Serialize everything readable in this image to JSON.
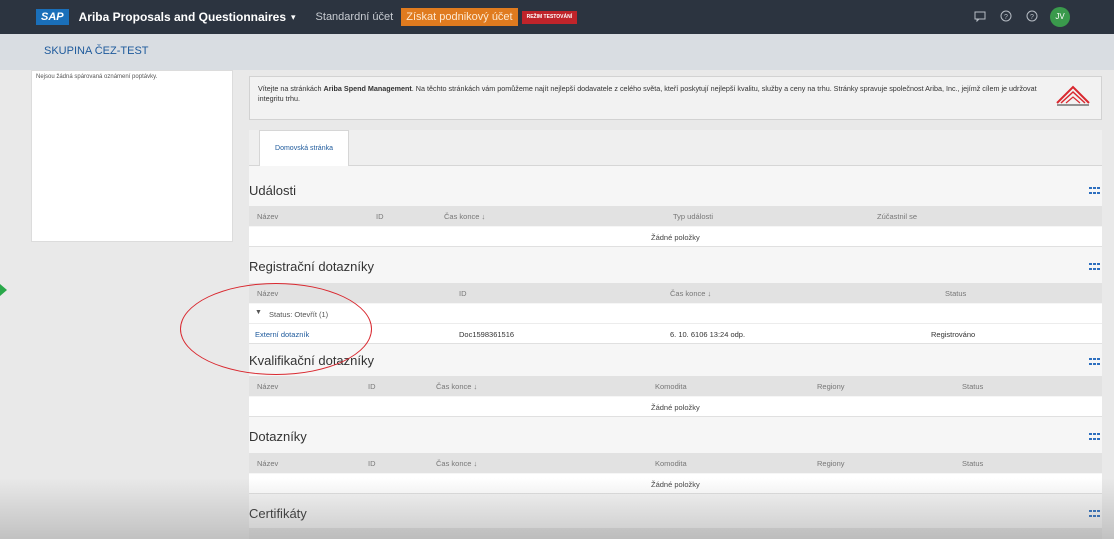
{
  "topbar": {
    "logo": "SAP",
    "app_title": "Ariba Proposals and Questionnaires",
    "account_standard": "Standardní účet",
    "account_pro": "Získat podnikový účet",
    "test_mode": "REŽIM TESTOVÁNÍ",
    "avatar": "JV",
    "icons": [
      "notification-icon",
      "help-icon",
      "help-icon",
      "avatar"
    ]
  },
  "group": {
    "label": "SKUPINA ČEZ-TEST"
  },
  "left_panel": {
    "text": "Nejsou žádná spárovaná oznámení poptávky."
  },
  "welcome": {
    "intro": "Vítejte na stránkách ",
    "brand": "Ariba Spend Management",
    "rest": ". Na těchto stránkách vám pomůžeme najít nejlepší dodavatele z celého světa, kteří poskytují nejlepší kvalitu, služby a ceny na trhu. Stránky spravuje společnost Ariba, Inc., jejímž cílem je udržovat integritu trhu."
  },
  "tabs": [
    {
      "label": "Domovská stránka",
      "active": true
    }
  ],
  "sections": {
    "events": {
      "title": "Události",
      "columns": [
        "Název",
        "ID",
        "Čas konce ↓",
        "Typ události",
        "Zúčastnil se"
      ],
      "empty": "Žádné položky"
    },
    "registration": {
      "title": "Registrační dotazníky",
      "columns": [
        "Název",
        "ID",
        "Čas konce ↓",
        "Status"
      ],
      "group_label": "Status: Otevřít  (1)",
      "rows": [
        {
          "name": "Externí dotazník",
          "id": "Doc1598361516",
          "end": "6. 10. 6106 13:24 odp.",
          "status": "Registrováno"
        }
      ]
    },
    "qualification": {
      "title": "Kvalifikační dotazníky",
      "columns": [
        "Název",
        "ID",
        "Čas konce ↓",
        "Komodita",
        "Regiony",
        "Status"
      ],
      "empty": "Žádné položky"
    },
    "questionnaires": {
      "title": "Dotazníky",
      "columns": [
        "Název",
        "ID",
        "Čas konce ↓",
        "Komodita",
        "Regiony",
        "Status"
      ],
      "empty": "Žádné položky"
    },
    "certificates": {
      "title": "Certifikáty"
    }
  },
  "colors": {
    "topbar": "#2c3440",
    "accent_orange": "#e07b1f",
    "test_red": "#c0242a",
    "link_blue": "#1e5a9c",
    "annotation_red": "#d9282f"
  }
}
